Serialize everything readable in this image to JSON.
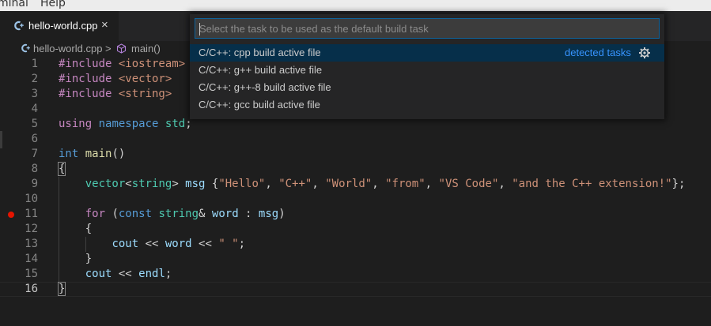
{
  "menubar": {
    "items": [
      "minal",
      "Help"
    ]
  },
  "tab": {
    "label": "hello-world.cpp",
    "close_glyph": "×",
    "icon": "cpp-file-icon"
  },
  "breadcrumb": {
    "file": "hello-world.cpp",
    "separator": ">",
    "symbol": "main()",
    "symbol_icon": "method-cube-icon"
  },
  "editor": {
    "current_line": 16,
    "breakpoint_line": 11,
    "lines": [
      {
        "n": "1",
        "tokens": [
          [
            "dir",
            "#include "
          ],
          [
            "inc",
            "<iostream>"
          ]
        ]
      },
      {
        "n": "2",
        "tokens": [
          [
            "dir",
            "#include "
          ],
          [
            "inc",
            "<vector>"
          ]
        ]
      },
      {
        "n": "3",
        "tokens": [
          [
            "dir",
            "#include "
          ],
          [
            "inc",
            "<string>"
          ]
        ]
      },
      {
        "n": "4",
        "tokens": []
      },
      {
        "n": "5",
        "tokens": [
          [
            "ctl",
            "using"
          ],
          [
            "op",
            " "
          ],
          [
            "kw",
            "namespace"
          ],
          [
            "op",
            " "
          ],
          [
            "type",
            "std"
          ],
          [
            "op",
            ";"
          ]
        ]
      },
      {
        "n": "6",
        "tokens": []
      },
      {
        "n": "7",
        "tokens": [
          [
            "kw",
            "int"
          ],
          [
            "op",
            " "
          ],
          [
            "fn",
            "main"
          ],
          [
            "op",
            "()"
          ]
        ]
      },
      {
        "n": "8",
        "tokens": [
          [
            "op",
            "{"
          ]
        ]
      },
      {
        "n": "9",
        "tokens": [
          [
            "op",
            "    "
          ],
          [
            "type",
            "vector"
          ],
          [
            "op",
            "<"
          ],
          [
            "type",
            "string"
          ],
          [
            "op",
            "> "
          ],
          [
            "var",
            "msg"
          ],
          [
            "op",
            " {"
          ],
          [
            "str",
            "\"Hello\""
          ],
          [
            "op",
            ", "
          ],
          [
            "str",
            "\"C++\""
          ],
          [
            "op",
            ", "
          ],
          [
            "str",
            "\"World\""
          ],
          [
            "op",
            ", "
          ],
          [
            "str",
            "\"from\""
          ],
          [
            "op",
            ", "
          ],
          [
            "str",
            "\"VS Code\""
          ],
          [
            "op",
            ", "
          ],
          [
            "str",
            "\"and the C++ extension!\""
          ],
          [
            "op",
            "};"
          ]
        ]
      },
      {
        "n": "10",
        "tokens": []
      },
      {
        "n": "11",
        "tokens": [
          [
            "op",
            "    "
          ],
          [
            "ctl",
            "for"
          ],
          [
            "op",
            " ("
          ],
          [
            "kw",
            "const"
          ],
          [
            "op",
            " "
          ],
          [
            "type",
            "string"
          ],
          [
            "op",
            "& "
          ],
          [
            "var",
            "word"
          ],
          [
            "op",
            " : "
          ],
          [
            "var",
            "msg"
          ],
          [
            "op",
            ")"
          ]
        ]
      },
      {
        "n": "12",
        "tokens": [
          [
            "op",
            "    {"
          ]
        ]
      },
      {
        "n": "13",
        "tokens": [
          [
            "op",
            "        "
          ],
          [
            "var",
            "cout"
          ],
          [
            "op",
            " << "
          ],
          [
            "var",
            "word"
          ],
          [
            "op",
            " << "
          ],
          [
            "str",
            "\" \""
          ],
          [
            "op",
            ";"
          ]
        ]
      },
      {
        "n": "14",
        "tokens": [
          [
            "op",
            "    }"
          ]
        ]
      },
      {
        "n": "15",
        "tokens": [
          [
            "op",
            "    "
          ],
          [
            "var",
            "cout"
          ],
          [
            "op",
            " << "
          ],
          [
            "var",
            "endl"
          ],
          [
            "op",
            ";"
          ]
        ]
      },
      {
        "n": "16",
        "tokens": [
          [
            "op",
            "}"
          ]
        ]
      }
    ]
  },
  "quickpick": {
    "placeholder": "Select the task to be used as the default build task",
    "value": "",
    "items": [
      {
        "label": "C/C++: cpp build active file",
        "description": "detected tasks",
        "icon": "gear-icon",
        "active": true
      },
      {
        "label": "C/C++: g++ build active file",
        "description": "",
        "icon": "",
        "active": false
      },
      {
        "label": "C/C++: g++-8 build active file",
        "description": "",
        "icon": "",
        "active": false
      },
      {
        "label": "C/C++: gcc build active file",
        "description": "",
        "icon": "",
        "active": false
      }
    ]
  },
  "colors": {
    "editor_bg": "#1e1e1e",
    "accent": "#0e639c",
    "link": "#3794ff",
    "breakpoint": "#e51400",
    "selection": "#062f4a"
  }
}
